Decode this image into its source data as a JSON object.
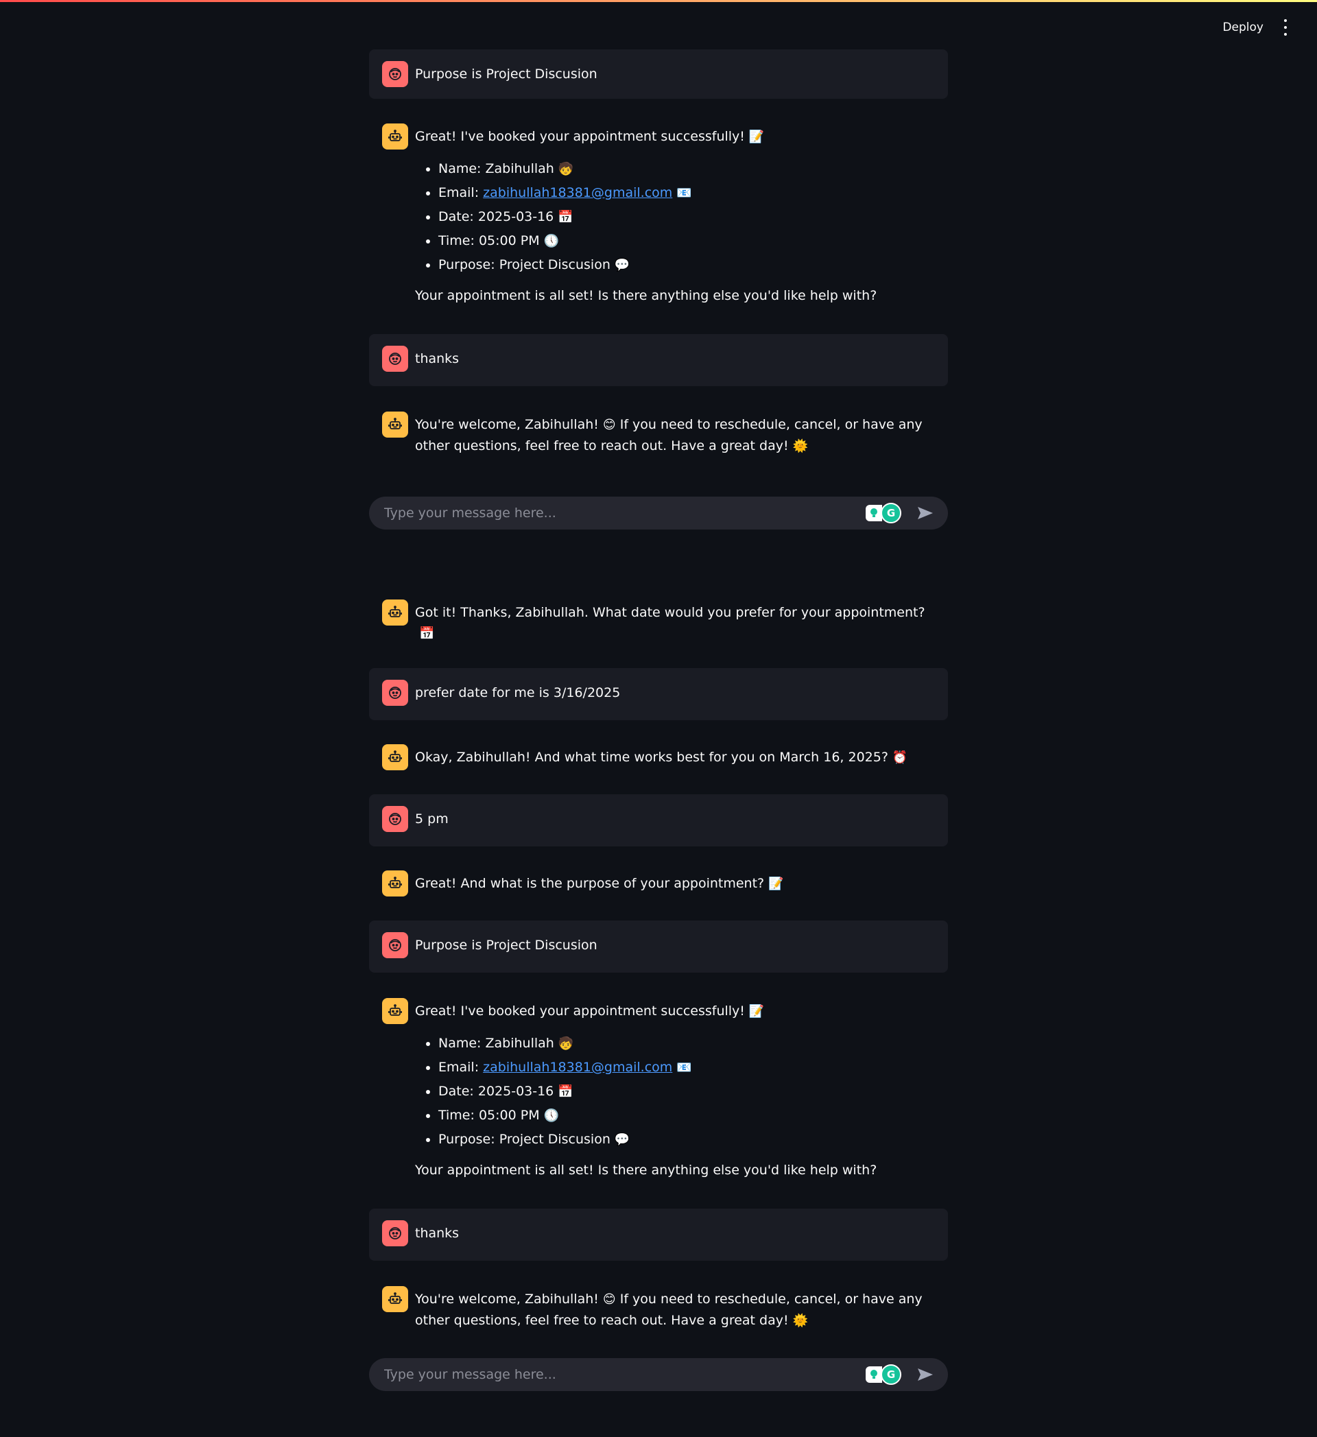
{
  "header": {
    "deploy_label": "Deploy"
  },
  "colors": {
    "user_avatar": "#ff6c6c",
    "bot_avatar": "#ffbd45",
    "link": "#4c9aff",
    "background": "#0e1117"
  },
  "input": {
    "placeholder": "Type your message here..."
  },
  "messages_top": {
    "m1": {
      "text": "Purpose is Project Discusion"
    },
    "m2": {
      "intro": "Great! I've booked your appointment successfully!",
      "intro_emoji": "📝",
      "name_label": "Name: Zabihullah",
      "name_emoji": "🧒",
      "email_label": "Email:",
      "email_link": "zabihullah18381@gmail.com",
      "email_emoji": "📧",
      "date_label": "Date: 2025-03-16",
      "date_emoji": "📅",
      "time_label": "Time: 05:00 PM",
      "time_emoji": "🕔",
      "purpose_label": "Purpose: Project Discusion",
      "purpose_emoji": "💬",
      "outro": "Your appointment is all set! Is there anything else you'd like help with?"
    },
    "m3": {
      "text": "thanks"
    },
    "m4": {
      "text_a": "You're welcome, Zabihullah!",
      "emoji_a": "😊",
      "text_b": "If you need to reschedule, cancel, or have any other questions, feel free to reach out. Have a great day!",
      "emoji_b": "🌞"
    }
  },
  "messages_bottom": {
    "b1": {
      "text": "Got it! Thanks, Zabihullah. What date would you prefer for your appointment?",
      "emoji": "📅"
    },
    "b2": {
      "text": "prefer date for me is 3/16/2025"
    },
    "b3": {
      "text": "Okay, Zabihullah! And what time works best for you on March 16, 2025?",
      "emoji": "⏰"
    },
    "b4": {
      "text": "5 pm"
    },
    "b5": {
      "text": "Great! And what is the purpose of your appointment?",
      "emoji": "📝"
    },
    "b6": {
      "text": "Purpose is Project Discusion"
    },
    "b7": {
      "intro": "Great! I've booked your appointment successfully!",
      "intro_emoji": "📝",
      "name_label": "Name: Zabihullah",
      "name_emoji": "🧒",
      "email_label": "Email:",
      "email_link": "zabihullah18381@gmail.com",
      "email_emoji": "📧",
      "date_label": "Date: 2025-03-16",
      "date_emoji": "📅",
      "time_label": "Time: 05:00 PM",
      "time_emoji": "🕔",
      "purpose_label": "Purpose: Project Discusion",
      "purpose_emoji": "💬",
      "outro": "Your appointment is all set! Is there anything else you'd like help with?"
    },
    "b8": {
      "text": "thanks"
    },
    "b9": {
      "text_a": "You're welcome, Zabihullah!",
      "emoji_a": "😊",
      "text_b": "If you need to reschedule, cancel, or have any other questions, feel free to reach out. Have a great day!",
      "emoji_b": "🌞"
    }
  }
}
